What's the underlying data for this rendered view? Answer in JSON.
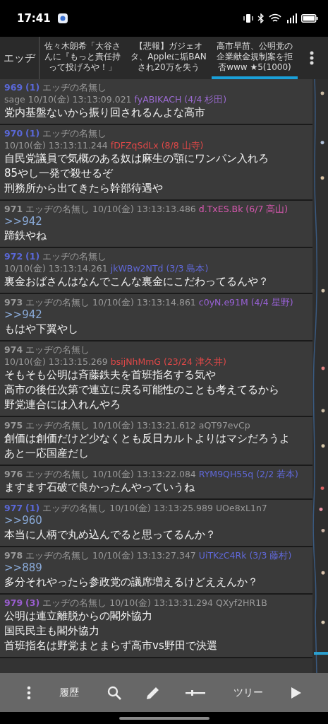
{
  "status_bar": {
    "time": "17:41"
  },
  "tab_bar": {
    "board": "エッヂ",
    "tabs": [
      {
        "title": "佐々木朗希「大谷さんに『もっと責任持って投げろや！」",
        "selected": false
      },
      {
        "title": "【悲報】ガジェオタ、Appleに垢BANされ20万を失う",
        "selected": false
      },
      {
        "title": "高市早苗、公明党の企業献金規制案を拒否www ★5(1000)",
        "selected": true
      }
    ]
  },
  "posts": [
    {
      "kind": "replied",
      "number": "969",
      "count": "(1)",
      "name": "エッヂの名無し",
      "mail": "sage",
      "date": "10/10(金) 13:13:09.021",
      "id": "fyABIKACH (4/4 杉田)",
      "color": "#9a6ad0",
      "lines": [
        "党内基盤ないから振り回されるんよな高市"
      ]
    },
    {
      "kind": "replied",
      "number": "970",
      "count": "(1)",
      "name": "エッヂの名無し",
      "date": "10/10(金) 13:13:11.244",
      "id": "fDFZqSdLx (8/8 山寺)",
      "color": "#e04848",
      "lines": [
        "自民党議員で気概のある奴は麻生の顎にワンパン入れろ",
        "85やし一発で殺せるぞ",
        "刑務所から出てきたら幹部待遇や"
      ]
    },
    {
      "kind": "plain",
      "number": "971",
      "name": "エッヂの名無し",
      "date": "10/10(金) 13:13:13.486",
      "id": "d.TxES.Bk (6/7 高山)",
      "color": "#d858b0",
      "reply_to": ">>942",
      "lines": [
        "蹄鉄やね"
      ]
    },
    {
      "kind": "replied",
      "number": "972",
      "count": "(1)",
      "name": "エッヂの名無し",
      "date": "10/10(金) 13:13:14.261",
      "id": "jkWBw2NTd (3/3 島本)",
      "color": "#6068d8",
      "lines": [
        "裏金おばさんはなんでこんな裏金にこだわってるんや？"
      ]
    },
    {
      "kind": "plain",
      "number": "973",
      "name": "エッヂの名無し",
      "date": "10/10(金) 13:13:14.861",
      "id": "c0yN.e91M (4/4 星野)",
      "color": "#9a62d8",
      "reply_to": ">>942",
      "lines": [
        "もはや下翼やし"
      ]
    },
    {
      "kind": "plain",
      "number": "974",
      "name": "エッヂの名無し",
      "date": "10/10(金) 13:13:15.269",
      "id": "bsijNhMmG (23/24 津久井)",
      "color": "#e04848",
      "lines": [
        "そもそも公明は斉藤鉄夫を首班指名する気や",
        "高市の後任次第で連立に戻る可能性のことも考えてるから",
        "野党連合には入れんやろ"
      ]
    },
    {
      "kind": "plain",
      "number": "975",
      "name": "エッヂの名無し",
      "date": "10/10(金) 13:13:21.612",
      "id": "aQT97evCp",
      "lines": [
        "創価は創価だけど少なくとも反日カルトよりはマシだろうよ",
        "あと一応国産だし"
      ]
    },
    {
      "kind": "plain",
      "number": "976",
      "name": "エッヂの名無し",
      "date": "10/10(金) 13:13:22.084",
      "id": "RYM9QH55q (2/2 若本)",
      "color": "#6068d8",
      "lines": [
        "ますます石破で良かったんやっていうね"
      ]
    },
    {
      "kind": "replied",
      "number": "977",
      "count": "(1)",
      "name": "エッヂの名無し",
      "date": "10/10(金) 13:13:25.989",
      "id": "UOe8xL1n7",
      "reply_to": ">>960",
      "lines": [
        "本当に人柄で丸め込んでると思ってるんか？"
      ]
    },
    {
      "kind": "plain",
      "number": "978",
      "name": "エッヂの名無し",
      "date": "10/10(金) 13:13:27.347",
      "id": "UiTKzC4Rk (3/3 藤村)",
      "color": "#6068d8",
      "reply_to": ">>889",
      "lines": [
        "多分それやったら参政党の議席増えるけどええんか？"
      ]
    },
    {
      "kind": "popular",
      "number": "979",
      "count": "(3)",
      "name": "エッヂの名無し",
      "date": "10/10(金) 13:13:31.294",
      "id": "QXyf2HR1B",
      "lines": [
        "公明は連立離脱からの閣外協力",
        "国民民主も閣外協力",
        "首班指名は野党まとまらず高市vs野田で決選"
      ]
    }
  ],
  "toolbar": {
    "items": [
      {
        "kind": "menu"
      },
      {
        "kind": "text",
        "label": "履歴"
      },
      {
        "kind": "search"
      },
      {
        "kind": "pen"
      },
      {
        "kind": "slider"
      },
      {
        "kind": "text",
        "label": "ツリー"
      },
      {
        "kind": "play"
      }
    ]
  }
}
